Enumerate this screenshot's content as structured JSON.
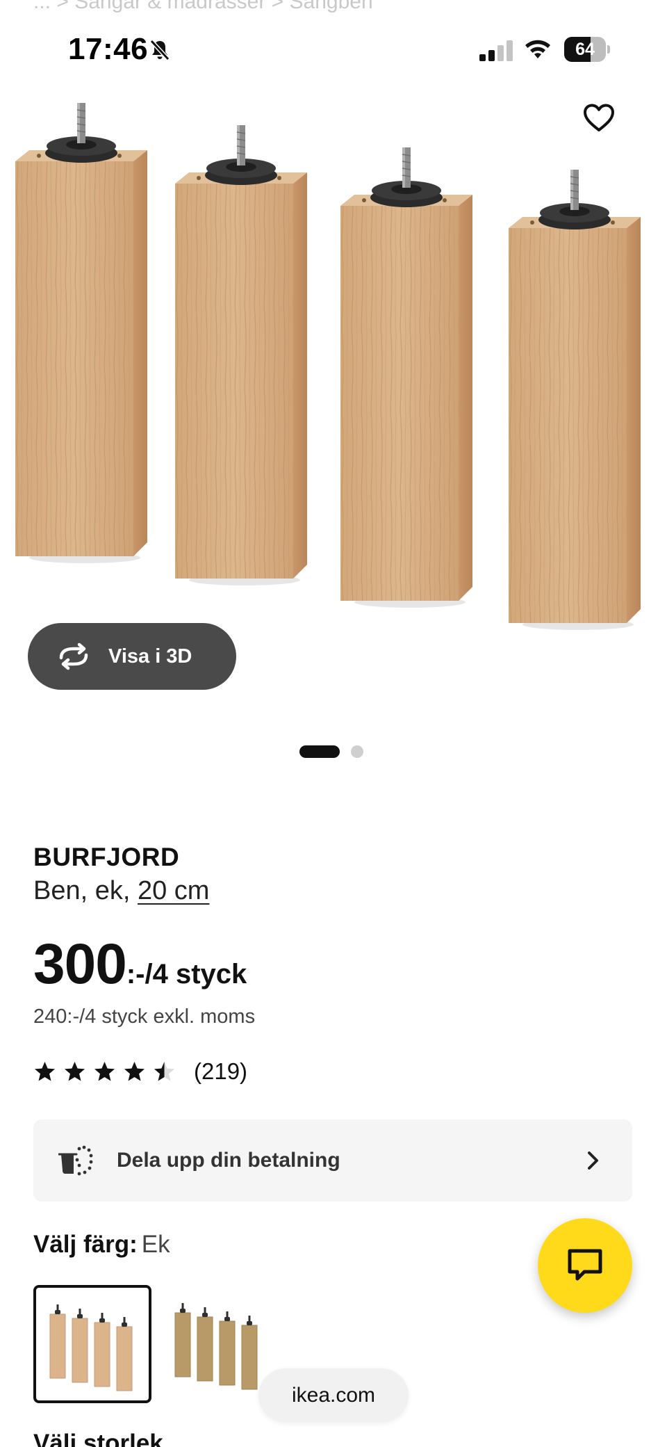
{
  "breadcrumb_fragment": "... > Sängar & madrasser > Sängben",
  "status_bar": {
    "time": "17:46",
    "battery_percent": "64",
    "battery_level": 0.64
  },
  "product": {
    "name": "BURFJORD",
    "description_prefix": "Ben, ek,",
    "size_link": "20 cm",
    "price_main": "300",
    "price_suffix": ":-/4 styck",
    "price_excl_vat": "240:-/4 styck exkl. moms",
    "rating_value": 4.5,
    "rating_max": 5,
    "review_count": "(219)"
  },
  "actions": {
    "view_3d_label": "Visa i 3D"
  },
  "carousel": {
    "total": 2,
    "active": 1
  },
  "payment": {
    "label": "Dela upp din betalning"
  },
  "color": {
    "label": "Välj färg:",
    "value": "Ek",
    "swatches": [
      "Ek",
      "Ek, betsad"
    ]
  },
  "size": {
    "label": "Välj storlek"
  },
  "browser": {
    "url": "ikea.com"
  },
  "icons": {
    "favorite": "heart-icon",
    "rotate": "rotate-3d-icon",
    "payment": "payment-split-icon",
    "chevron": "chevron-right-icon",
    "chat": "chat-icon",
    "bell": "bell-off-icon"
  },
  "colors": {
    "chat_button": "#ffda1a",
    "view3d_button": "#4a4a4a",
    "wood": "#d9b38a"
  }
}
